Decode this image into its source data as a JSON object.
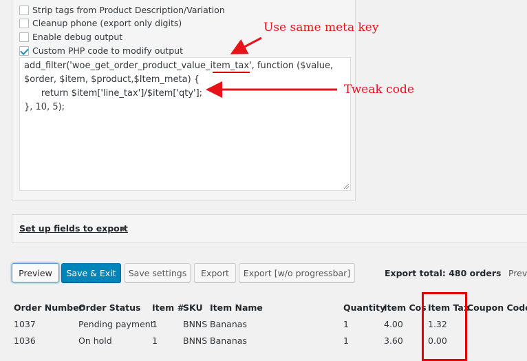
{
  "options": [
    {
      "label": "Strip tags from Product Description/Variation",
      "checked": false
    },
    {
      "label": "Cleanup phone (export only digits)",
      "checked": false
    },
    {
      "label": "Enable debug output",
      "checked": false
    },
    {
      "label": "Custom PHP code to modify output",
      "checked": true
    }
  ],
  "code": {
    "line1": "add_filter('woe_get_order_product_value_item_tax', function ($value,",
    "line2": "$order, $item, $product,$Item_meta) {",
    "line3": "      return $item['line_tax']/$item['qty'];",
    "line4": "}, 10, 5);"
  },
  "annotations": {
    "meta_key": "Use same meta key",
    "tweak": "Tweak code"
  },
  "fields_link": "Set up fields to export",
  "buttons": {
    "preview": "Preview",
    "save_exit": "Save & Exit",
    "save_settings": "Save settings",
    "export": "Export",
    "export_no_progress": "Export [w/o progressbar]"
  },
  "export_total": "Export total: 480 orders",
  "preview_label": "Previ",
  "table": {
    "headers": [
      "Order Number",
      "Order Status",
      "Item #",
      "SKU",
      "Item Name",
      "Quantity",
      "Item Cos",
      "Item Tax",
      "Coupon Code"
    ],
    "rows": [
      [
        "1037",
        "Pending payment",
        "1",
        "BNNS",
        "Bananas",
        "1",
        "4.00",
        "1.32",
        ""
      ],
      [
        "1036",
        "On hold",
        "1",
        "BNNS",
        "Bananas",
        "1",
        "3.60",
        "0.00",
        ""
      ]
    ]
  },
  "colors": {
    "annotation": "#e8121a",
    "primary_button": "#0085ba"
  }
}
